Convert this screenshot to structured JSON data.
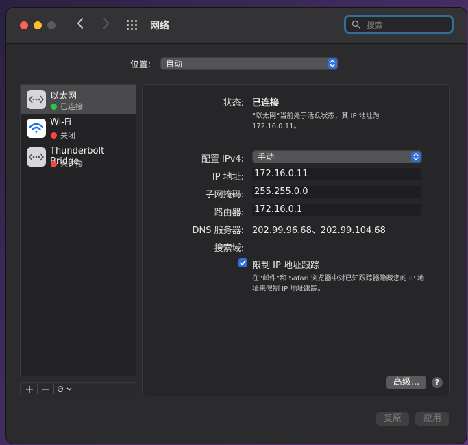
{
  "window": {
    "title": "网络",
    "search": {
      "placeholder": "搜索",
      "value": ""
    }
  },
  "location": {
    "label": "位置:",
    "value": "自动"
  },
  "sidebar": {
    "items": [
      {
        "name": "以太网",
        "status": "已连接",
        "status_color": "#27c93f",
        "icon": "ethernet-icon",
        "selected": true
      },
      {
        "name": "Wi-Fi",
        "status": "关闭",
        "status_color": "#ff453a",
        "icon": "wifi-icon",
        "selected": false
      },
      {
        "name": "Thunderbolt Bridge",
        "status": "未连接",
        "status_color": "#ff453a",
        "icon": "thunderbolt-bridge-icon",
        "selected": false
      }
    ],
    "tools": {
      "add": "+",
      "remove": "−",
      "more": "⊝"
    }
  },
  "detail": {
    "status_label": "状态:",
    "status_value": "已连接",
    "status_note_line1": "“以太网”当前处于活跃状态，其 IP 地址为",
    "status_note_line2": "172.16.0.11。",
    "ipv4_label": "配置 IPv4:",
    "ipv4_value": "手动",
    "ip_label": "IP 地址:",
    "ip_value": "172.16.0.11",
    "subnet_label": "子网掩码:",
    "subnet_value": "255.255.0.0",
    "router_label": "路由器:",
    "router_value": "172.16.0.1",
    "dns_label": "DNS 服务器:",
    "dns_value": "202.99.96.68、202.99.104.68",
    "search_domain_label": "搜索域:",
    "limit_ip_label": "限制 IP 地址跟踪",
    "limit_ip_checked": true,
    "limit_ip_note_line1": "在“邮件”和 Safari 浏览器中对已知跟踪器隐藏您的 IP 地",
    "limit_ip_note_line2": "址来限制 IP 地址跟踪。",
    "advanced_label": "高级...",
    "help_label": "?"
  },
  "footer": {
    "revert_label": "复原",
    "apply_label": "应用"
  },
  "colors": {
    "accent": "#2f6fd6",
    "close": "#fe5f57",
    "minimize": "#febc2e"
  }
}
